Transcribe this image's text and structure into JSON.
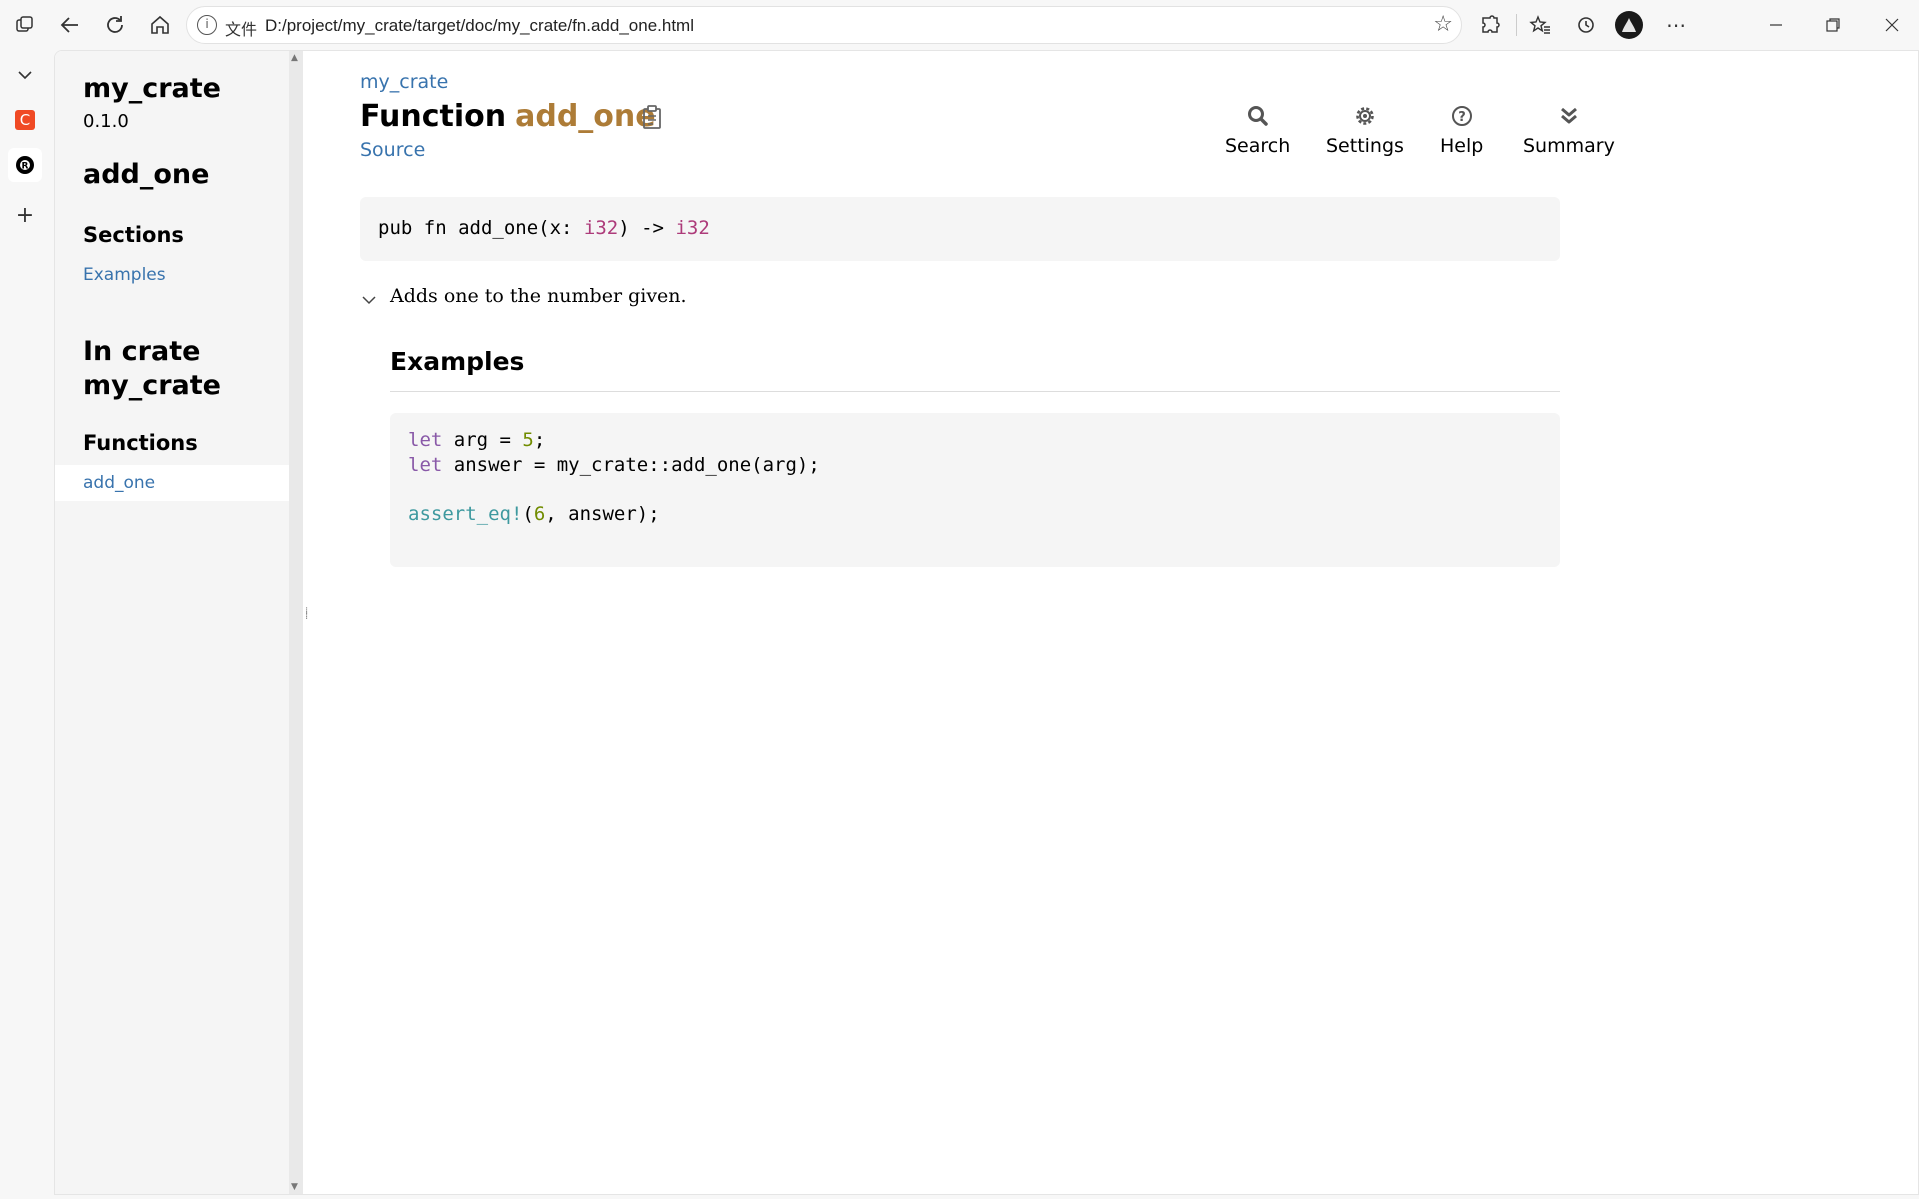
{
  "browser": {
    "address_label": "文件",
    "url": "D:/project/my_crate/target/doc/my_crate/fn.add_one.html",
    "colors": {
      "tab_red": "#f04a24",
      "chrome_bg": "#f7f7f7"
    }
  },
  "sidebar": {
    "crate_name": "my_crate",
    "version": "0.1.0",
    "item_name": "add_one",
    "sections_heading": "Sections",
    "sections": [
      "Examples"
    ],
    "in_crate_heading": "In crate my_crate",
    "functions_heading": "Functions",
    "functions": [
      "add_one"
    ]
  },
  "main": {
    "breadcrumb": "my_crate",
    "title_kind": "Function",
    "title_name": "add_one",
    "source_link": "Source",
    "toolbar": {
      "search": "Search",
      "settings": "Settings",
      "help": "Help",
      "summary": "Summary"
    },
    "signature": {
      "prefix": "pub fn add_one(x: ",
      "arg_type": "i32",
      "middle": ") -> ",
      "ret_type": "i32"
    },
    "description": "Adds one to the number given.",
    "examples_heading": "Examples",
    "code": {
      "l1_kw": "let",
      "l1_mid": " arg = ",
      "l1_num": "5",
      "l1_end": ";",
      "l2_kw": "let",
      "l2_rest": " answer = my_crate::add_one(arg);",
      "l3_macro": "assert_eq!",
      "l3_open": "(",
      "l3_num": "6",
      "l3_rest": ", answer);"
    },
    "colors": {
      "link": "#3873ad",
      "fn_name": "#ad7c37",
      "type": "#ad3b7a",
      "keyword": "#8959a8",
      "number": "#718c00",
      "macro": "#3e999f"
    }
  }
}
